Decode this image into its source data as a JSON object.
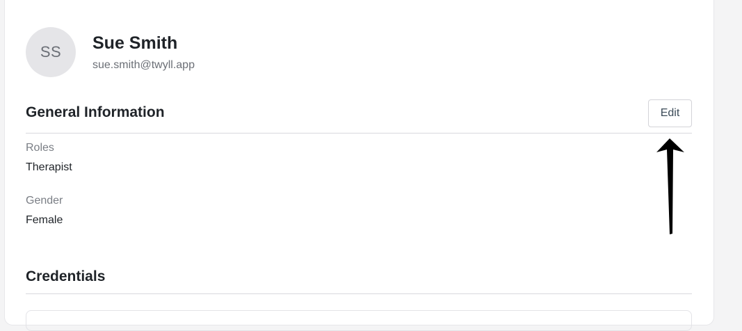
{
  "profile": {
    "initials": "SS",
    "name": "Sue Smith",
    "email": "sue.smith@twyll.app"
  },
  "general": {
    "title": "General Information",
    "edit_label": "Edit",
    "fields": [
      {
        "label": "Roles",
        "value": "Therapist"
      },
      {
        "label": "Gender",
        "value": "Female"
      }
    ]
  },
  "credentials": {
    "title": "Credentials"
  },
  "colors": {
    "text_primary": "#1f2328",
    "text_muted": "#7a7e85",
    "avatar_bg": "#e5e5e8",
    "arrow": "#000000"
  }
}
